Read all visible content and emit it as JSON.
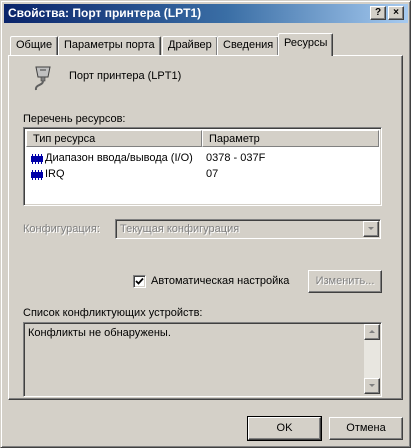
{
  "window": {
    "title": "Свойства: Порт принтера (LPT1)",
    "help_label": "?",
    "close_label": "×"
  },
  "tabs": [
    {
      "label": "Общие"
    },
    {
      "label": "Параметры порта"
    },
    {
      "label": "Драйвер"
    },
    {
      "label": "Сведения"
    },
    {
      "label": "Ресурсы"
    }
  ],
  "device": {
    "icon": "printer-port-icon",
    "name": "Порт принтера (LPT1)"
  },
  "resources": {
    "label": "Перечень ресурсов:",
    "columns": [
      "Тип ресурса",
      "Параметр"
    ],
    "rows": [
      {
        "icon": "chip-icon",
        "type": "Диапазон ввода/вывода (I/O)",
        "value": "0378 - 037F"
      },
      {
        "icon": "chip-icon",
        "type": "IRQ",
        "value": "07"
      }
    ]
  },
  "configuration": {
    "label": "Конфигурация:",
    "selected": "Текущая конфигурация"
  },
  "auto_settings": {
    "label": "Автоматическая настройка",
    "checked": true,
    "change_button": "Изменить..."
  },
  "conflicts": {
    "label": "Список конфликтующих устройств:",
    "text": "Конфликты не обнаружены."
  },
  "footer": {
    "ok": "OK",
    "cancel": "Отмена"
  },
  "colors": {
    "title_start": "#0a246a",
    "title_end": "#a6caf0",
    "face": "#d4d0c8",
    "chip": "#0000a8"
  }
}
